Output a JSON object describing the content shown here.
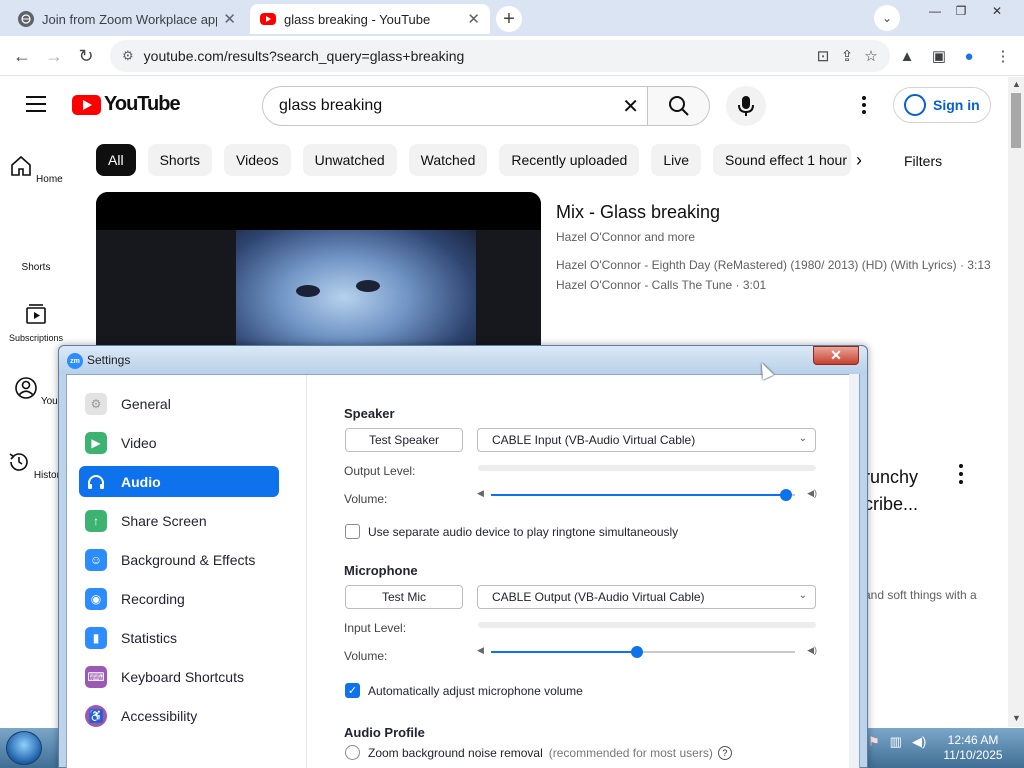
{
  "browser": {
    "tabs": [
      {
        "title": "Join from Zoom Workplace app",
        "active": false
      },
      {
        "title": "glass breaking - YouTube",
        "active": true
      }
    ],
    "url": "youtube.com/results?search_query=glass+breaking"
  },
  "youtube": {
    "logo_text": "YouTube",
    "search_query": "glass breaking",
    "sign_in_label": "Sign in",
    "chips": [
      "All",
      "Shorts",
      "Videos",
      "Unwatched",
      "Watched",
      "Recently uploaded",
      "Live",
      "Sound effect 1 hour"
    ],
    "filters_label": "Filters",
    "sidebar": [
      {
        "label": "Home",
        "icon": "home-icon"
      },
      {
        "label": "Shorts",
        "icon": "shorts-icon"
      },
      {
        "label": "Subscriptions",
        "icon": "subscriptions-icon"
      },
      {
        "label": "You",
        "icon": "you-icon"
      },
      {
        "label": "History",
        "icon": "history-icon"
      }
    ],
    "result": {
      "title": "Mix - Glass breaking",
      "channel": "Hazel O'Connor and more",
      "tracks": [
        "Hazel O'Connor - Eighth Day (ReMastered) (1980/ 2013) (HD) (With Lyrics) · 3:13",
        "Hazel O'Connor - Calls The Tune · 3:01"
      ]
    },
    "partial_text": {
      "title_line1": "runchy",
      "title_line2": "cribe...",
      "desc": "and soft things with a"
    }
  },
  "zoom_settings": {
    "window_title": "Settings",
    "nav": [
      {
        "label": "General",
        "icon": "general-icon",
        "color": "#e8e8e8"
      },
      {
        "label": "Video",
        "icon": "video-icon",
        "color": "#3cb371"
      },
      {
        "label": "Audio",
        "icon": "headphones-icon",
        "color": "#0e72ed",
        "active": true
      },
      {
        "label": "Share Screen",
        "icon": "share-screen-icon",
        "color": "#3cb371"
      },
      {
        "label": "Background & Effects",
        "icon": "background-icon",
        "color": "#2d8cff"
      },
      {
        "label": "Recording",
        "icon": "recording-icon",
        "color": "#2d8cff"
      },
      {
        "label": "Statistics",
        "icon": "statistics-icon",
        "color": "#2d8cff"
      },
      {
        "label": "Keyboard Shortcuts",
        "icon": "keyboard-icon",
        "color": "#9b59b6"
      },
      {
        "label": "Accessibility",
        "icon": "accessibility-icon",
        "color": "#9b59b6"
      }
    ],
    "speaker": {
      "section": "Speaker",
      "test_button": "Test Speaker",
      "device": "CABLE Input (VB-Audio Virtual Cable)",
      "output_level_label": "Output Level:",
      "volume_label": "Volume:",
      "volume": 0.97
    },
    "separate_ringtone": {
      "label": "Use separate audio device to play ringtone simultaneously",
      "checked": false
    },
    "microphone": {
      "section": "Microphone",
      "test_button": "Test Mic",
      "device": "CABLE Output (VB-Audio Virtual Cable)",
      "input_level_label": "Input Level:",
      "volume_label": "Volume:",
      "volume": 0.48
    },
    "auto_adjust": {
      "label": "Automatically adjust microphone volume",
      "checked": true
    },
    "audio_profile": {
      "section": "Audio Profile",
      "option": "Zoom background noise removal",
      "hint": "(recommended for most users)"
    }
  },
  "taskbar": {
    "time": "12:46 AM",
    "date": "11/10/2025"
  }
}
